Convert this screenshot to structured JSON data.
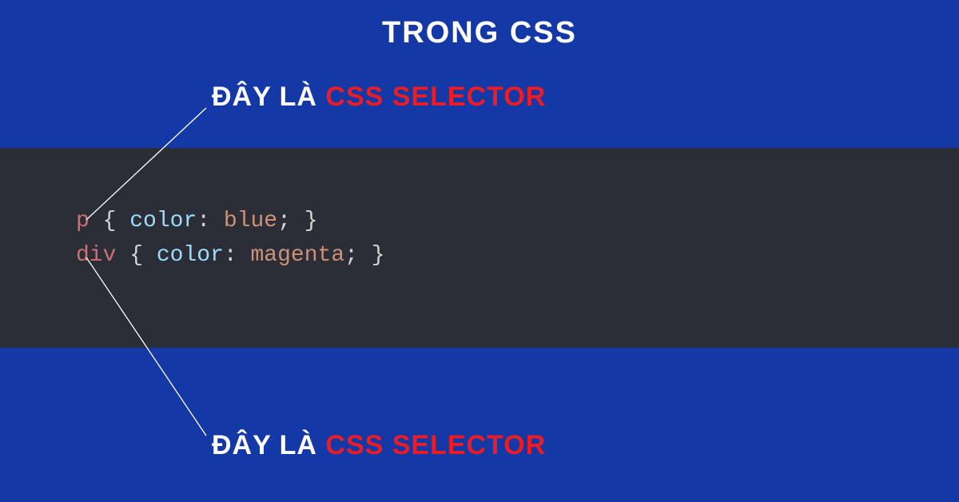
{
  "header": {
    "title": "TRONG CSS"
  },
  "annotations": {
    "top": {
      "prefix": "ĐÂY LÀ ",
      "highlight": "CSS SELECTOR"
    },
    "bottom": {
      "prefix": "ĐÂY LÀ ",
      "highlight": "CSS SELECTOR"
    }
  },
  "code": {
    "lines": [
      {
        "selector": "p",
        "prop": "color",
        "value": "blue"
      },
      {
        "selector": "div",
        "prop": "color",
        "value": "magenta"
      }
    ]
  },
  "colors": {
    "background": "#1438a6",
    "codeBackground": "#2b2e36",
    "accent": "#ed1c24",
    "text": "#ffffff"
  }
}
